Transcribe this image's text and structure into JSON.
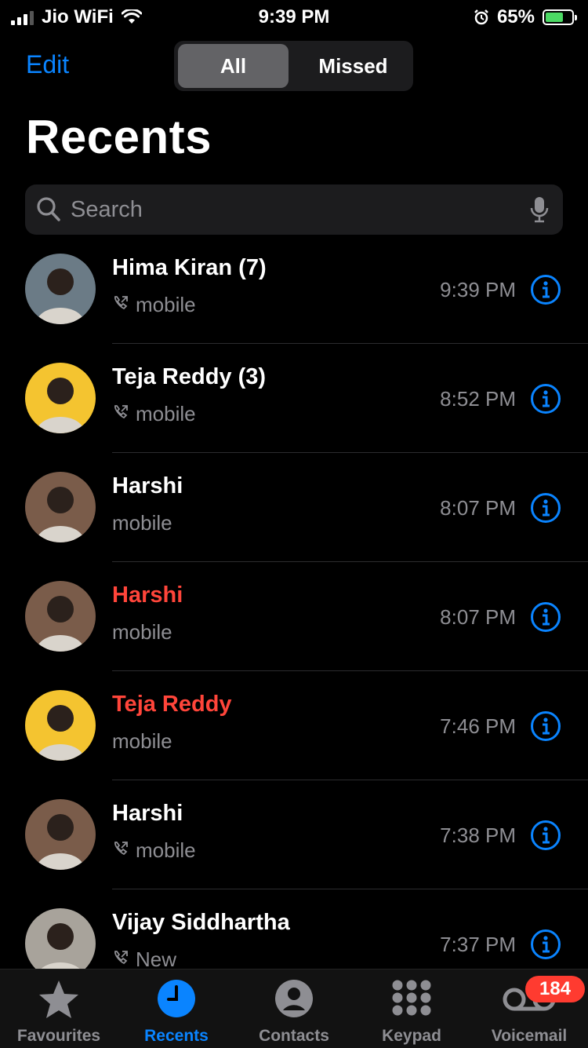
{
  "status_bar": {
    "carrier": "Jio WiFi",
    "time": "9:39 PM",
    "battery_percent": "65%",
    "signal_bars": 3,
    "battery_level": 0.65,
    "charging": true
  },
  "header": {
    "edit_label": "Edit",
    "segments": [
      {
        "label": "All",
        "selected": true
      },
      {
        "label": "Missed",
        "selected": false
      }
    ],
    "title": "Recents"
  },
  "search": {
    "placeholder": "Search"
  },
  "calls": [
    {
      "name": "Hima Kiran (7)",
      "type": "mobile",
      "time": "9:39 PM",
      "missed": false,
      "outgoing_icon": true,
      "avatar_color": "#6b7b86"
    },
    {
      "name": "Teja Reddy (3)",
      "type": "mobile",
      "time": "8:52 PM",
      "missed": false,
      "outgoing_icon": true,
      "avatar_color": "#f4c430"
    },
    {
      "name": "Harshi",
      "type": "mobile",
      "time": "8:07 PM",
      "missed": false,
      "outgoing_icon": false,
      "avatar_color": "#7a5c4a"
    },
    {
      "name": "Harshi",
      "type": "mobile",
      "time": "8:07 PM",
      "missed": true,
      "outgoing_icon": false,
      "avatar_color": "#7a5c4a"
    },
    {
      "name": "Teja Reddy",
      "type": "mobile",
      "time": "7:46 PM",
      "missed": true,
      "outgoing_icon": false,
      "avatar_color": "#f4c430"
    },
    {
      "name": "Harshi",
      "type": "mobile",
      "time": "7:38 PM",
      "missed": false,
      "outgoing_icon": true,
      "avatar_color": "#7a5c4a"
    },
    {
      "name": "Vijay Siddhartha",
      "type": "New",
      "time": "7:37 PM",
      "missed": false,
      "outgoing_icon": true,
      "avatar_color": "#a8a39b"
    }
  ],
  "tab_bar": {
    "tabs": [
      {
        "label": "Favourites",
        "icon": "star-icon",
        "active": false
      },
      {
        "label": "Recents",
        "icon": "clock-icon",
        "active": true
      },
      {
        "label": "Contacts",
        "icon": "person-circle-icon",
        "active": false
      },
      {
        "label": "Keypad",
        "icon": "keypad-icon",
        "active": false
      },
      {
        "label": "Voicemail",
        "icon": "voicemail-icon",
        "active": false
      }
    ],
    "voicemail_badge": "184"
  },
  "colors": {
    "accent": "#0a84ff",
    "missed": "#ff453a",
    "secondary_text": "#8e8e93",
    "badge": "#ff3b30"
  }
}
